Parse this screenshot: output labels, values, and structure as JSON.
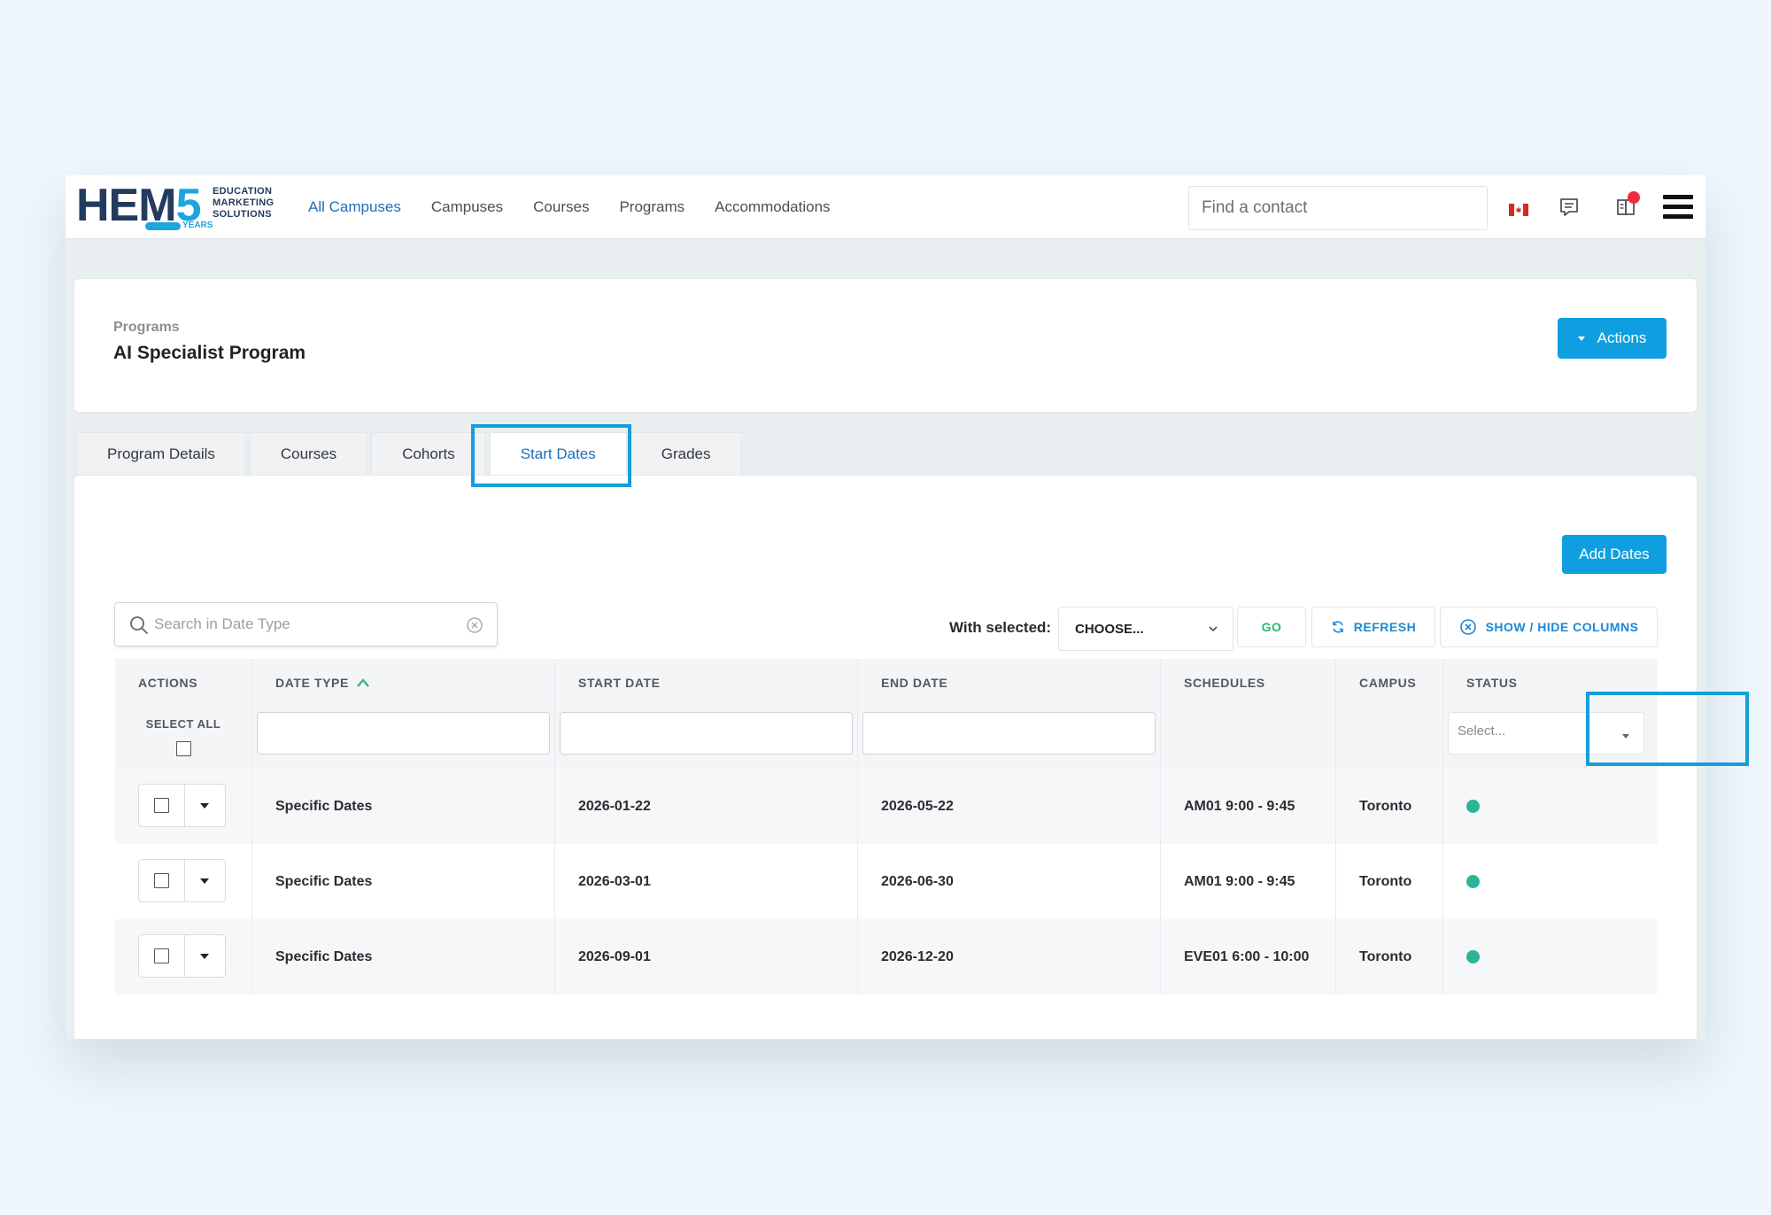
{
  "nav": {
    "logo_main": "HEM",
    "logo_five": "5",
    "logo_sub": [
      "EDUCATION",
      "MARKETING",
      "SOLUTIONS"
    ],
    "logo_years": "YEARS",
    "links": [
      {
        "label": "All Campuses",
        "active": true
      },
      {
        "label": "Campuses",
        "active": false
      },
      {
        "label": "Courses",
        "active": false
      },
      {
        "label": "Programs",
        "active": false
      },
      {
        "label": "Accommodations",
        "active": false
      }
    ],
    "search_placeholder": "Find a contact",
    "icons": [
      "canada-flag-icon",
      "chat-icon",
      "notifications-icon",
      "hamburger-menu-icon"
    ],
    "notification_dot_color": "#f02b3f"
  },
  "header": {
    "breadcrumb": "Programs",
    "title": "AI Specialist Program",
    "actions_label": "Actions"
  },
  "tabs": [
    {
      "label": "Program Details",
      "active": false
    },
    {
      "label": "Courses",
      "active": false
    },
    {
      "label": "Cohorts",
      "active": false
    },
    {
      "label": "Start Dates",
      "active": true
    },
    {
      "label": "Grades",
      "active": false
    }
  ],
  "content": {
    "add_dates_label": "Add Dates",
    "search_placeholder": "Search in Date Type",
    "with_selected_label": "With selected:",
    "choose_label": "CHOOSE...",
    "go_label": "GO",
    "refresh_label": "REFRESH",
    "show_hide_label": "SHOW / HIDE COLUMNS"
  },
  "table": {
    "columns": [
      "ACTIONS",
      "DATE TYPE",
      "START DATE",
      "END DATE",
      "SCHEDULES",
      "CAMPUS",
      "STATUS"
    ],
    "select_all_label": "SELECT ALL",
    "status_placeholder": "Select...",
    "rows": [
      {
        "date_type": "Specific Dates",
        "start_date": "2026-01-22",
        "end_date": "2026-05-22",
        "schedules": "AM01 9:00 - 9:45",
        "campus": "Toronto",
        "status_color": "#2bb597"
      },
      {
        "date_type": "Specific Dates",
        "start_date": "2026-03-01",
        "end_date": "2026-06-30",
        "schedules": "AM01 9:00 - 9:45",
        "campus": "Toronto",
        "status_color": "#2bb597"
      },
      {
        "date_type": "Specific Dates",
        "start_date": "2026-09-01",
        "end_date": "2026-12-20",
        "schedules": "EVE01 6:00 - 10:00",
        "campus": "Toronto",
        "status_color": "#2bb597"
      }
    ]
  },
  "colors": {
    "accent": "#0f9fe0",
    "highlight": "#159fd8",
    "link_active": "#1d6fb8",
    "go": "#2bb673"
  }
}
